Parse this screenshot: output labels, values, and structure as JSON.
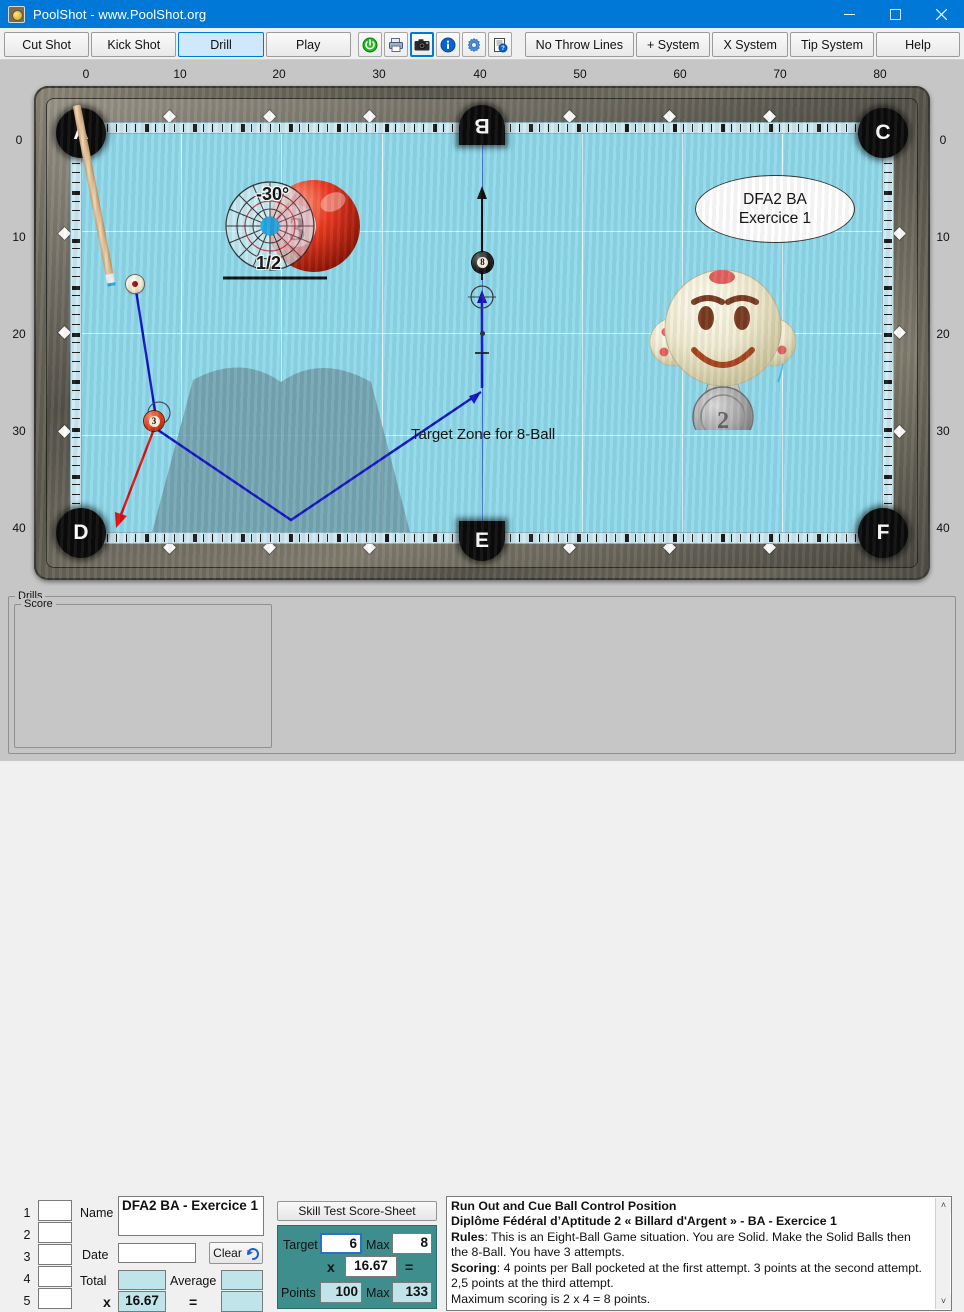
{
  "window": {
    "title": "PoolShot - www.PoolShot.org",
    "icon": "app-icon",
    "minimize": "–",
    "maximize": "☐",
    "close": "✕"
  },
  "toolbar": {
    "tabs": [
      {
        "label": "Cut Shot",
        "active": false
      },
      {
        "label": "Kick Shot",
        "active": false
      },
      {
        "label": "Drill",
        "active": true
      },
      {
        "label": "Play",
        "active": false
      }
    ],
    "icons": [
      {
        "name": "power-icon",
        "glyph": "⏻",
        "color": "#17a81a",
        "selected": false
      },
      {
        "name": "printer-icon",
        "glyph": "⎙",
        "color": "#4a5a74",
        "selected": false
      },
      {
        "name": "camera-icon",
        "glyph": "▣",
        "color": "#202020",
        "selected": true
      },
      {
        "name": "info-icon",
        "glyph": "i",
        "color": "#0b62c8",
        "selected": false
      },
      {
        "name": "gear-icon",
        "glyph": "⚙",
        "color": "#3b7ad0",
        "selected": false
      },
      {
        "name": "help-document-icon",
        "glyph": "⍰",
        "color": "#3a3a3a",
        "selected": false
      }
    ],
    "systems": [
      {
        "label": "No Throw Lines"
      },
      {
        "label": "+ System"
      },
      {
        "label": "X System"
      },
      {
        "label": "Tip System"
      },
      {
        "label": "Help"
      }
    ]
  },
  "table": {
    "ruler_top": [
      "0",
      "10",
      "20",
      "30",
      "40",
      "50",
      "60",
      "70",
      "80"
    ],
    "ruler_left": [
      "0",
      "10",
      "20",
      "30",
      "40"
    ],
    "ruler_right": [
      "0",
      "10",
      "20",
      "30",
      "40"
    ],
    "pockets": [
      {
        "id": "A",
        "pos": "top-left"
      },
      {
        "id": "B",
        "pos": "top-middle"
      },
      {
        "id": "C",
        "pos": "top-right"
      },
      {
        "id": "D",
        "pos": "bottom-left"
      },
      {
        "id": "E",
        "pos": "bottom-middle"
      },
      {
        "id": "F",
        "pos": "bottom-right"
      }
    ],
    "felt_color": "#8fd9ea",
    "rail_color": "#5d5a50",
    "zone_label": "Target Zone for 8-Ball",
    "zone_color": "#6f9aa6",
    "cue_path_color": "#1414c8",
    "object_path_color": "#e01010",
    "aim_diagram": {
      "angle": "-30°",
      "fraction": "1/2",
      "ball_number": "3"
    },
    "balls": [
      {
        "name": "cue-ball",
        "label": ""
      },
      {
        "name": "ball-8",
        "label": "8"
      },
      {
        "name": "ball-3",
        "label": "3"
      }
    ]
  },
  "mascot": {
    "bubble_line1": "DFA2 BA",
    "bubble_line2": "Exercice 1",
    "medal_number": "2"
  },
  "drills": {
    "group_label": "Drills",
    "score": {
      "group_label": "Score",
      "rows": [
        "1",
        "2",
        "3",
        "4",
        "5"
      ],
      "values": [
        "",
        "",
        "",
        "",
        ""
      ],
      "name_label": "Name",
      "name_value": "DFA2 BA - Exercice 1",
      "date_label": "Date",
      "date_value": "",
      "clear_label": "Clear",
      "total_label": "Total",
      "total_value": "",
      "average_label": "Average",
      "average_value": "",
      "multiplier_symbol": "x",
      "multiplier_value": "16.67",
      "equals_symbol": "=",
      "result_value": ""
    },
    "skill_test": {
      "title": "Skill Test Score-Sheet",
      "target_label": "Target",
      "target_value": "6",
      "target_max_label": "Max",
      "target_max_value": "8",
      "multiplier_symbol": "x",
      "multiplier_value": "16.67",
      "equals_symbol": "=",
      "points_label": "Points",
      "points_value": "100",
      "points_max_label": "Max",
      "points_max_value": "133"
    },
    "rules": {
      "heading1": "Run Out and Cue Ball Control Position",
      "heading2": "Diplôme Fédéral d’Aptitude 2 « Billard d'Argent » - BA - Exercice 1",
      "rules_label": "Rules",
      "rules_text": ": This is an Eight-Ball Game situation. You are Solid. Make the Solid Balls then the 8-Ball. You have 3 attempts.",
      "scoring_label": "Scoring",
      "scoring_text": ": 4 points per Ball pocketed at the first attempt. 3 points at the second attempt. 2,5 points at the third attempt.",
      "max_text": "Maximum scoring is 2 x 4 = 8 points.",
      "scroll_up": "˄",
      "scroll_down": "˅"
    }
  }
}
